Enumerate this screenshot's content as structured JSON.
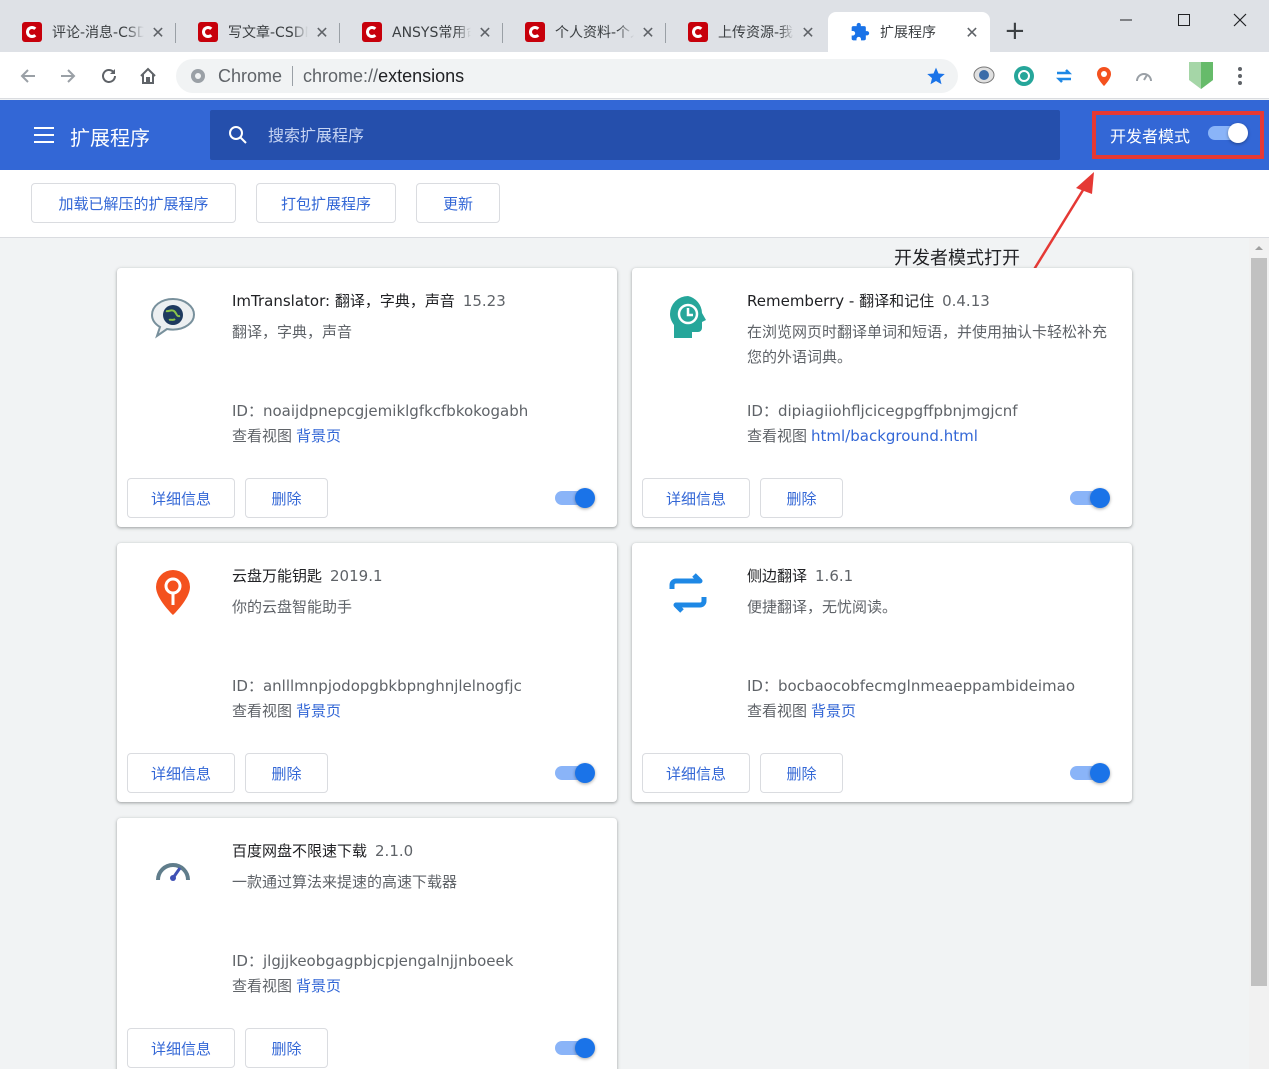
{
  "tabs": [
    {
      "title": "评论-消息-CSDN"
    },
    {
      "title": "写文章-CSDN博客"
    },
    {
      "title": "ANSYS常用命令"
    },
    {
      "title": "个人资料-个人中心"
    },
    {
      "title": "上传资源-我的资源"
    },
    {
      "title": "扩展程序"
    }
  ],
  "omnibox": {
    "chip": "Chrome",
    "scheme": "chrome://",
    "host": "extensions"
  },
  "header": {
    "title": "扩展程序",
    "search_placeholder": "搜索扩展程序",
    "dev_mode_label": "开发者模式"
  },
  "dev_buttons": {
    "load_unpacked": "加载已解压的扩展程序",
    "pack": "打包扩展程序",
    "update": "更新"
  },
  "annotation": "开发者模式打开",
  "labels": {
    "details": "详细信息",
    "remove": "删除",
    "id_prefix": "ID：",
    "inspect_views": "查看视图"
  },
  "extensions": [
    {
      "name": "ImTranslator: 翻译，字典，声音",
      "version": "15.23",
      "description": "翻译，字典，声音",
      "id": "noaijdpnepcgjemiklgfkcfbkokogabh",
      "view": "背景页",
      "icon": "imtranslator-icon",
      "enabled": true
    },
    {
      "name": "Rememberry - 翻译和记住",
      "version": "0.4.13",
      "description": "在浏览网页时翻译单词和短语，并使用抽认卡轻松补充您的外语词典。",
      "id": "dipiagiiohfljcicegpgffpbnjmgjcnf",
      "view": "html/background.html",
      "icon": "rememberry-icon",
      "enabled": true
    },
    {
      "name": "云盘万能钥匙",
      "version": "2019.1",
      "description": "你的云盘智能助手",
      "id": "anlllmnpjodopgbkbpnghnjlelnogfjc",
      "view": "背景页",
      "icon": "yunpan-key-icon",
      "enabled": true
    },
    {
      "name": "侧边翻译",
      "version": "1.6.1",
      "description": "便捷翻译，无忧阅读。",
      "id": "bocbaocobfecmglnmeaeppambideimao",
      "view": "背景页",
      "icon": "side-translate-icon",
      "enabled": true
    },
    {
      "name": "百度网盘不限速下载",
      "version": "2.1.0",
      "description": "一款通过算法来提速的高速下载器",
      "id": "jlgjjkeobgagpbjcpjengalnjjnboeek",
      "view": "背景页",
      "icon": "speedometer-icon",
      "enabled": true
    }
  ],
  "colors": {
    "header_blue": "#3367d6",
    "search_bg": "#254fac",
    "link_blue": "#3367d6",
    "toggle_knob": "#1a73e8",
    "toggle_track": "#8ab4f8",
    "highlight_red": "#e53935"
  }
}
